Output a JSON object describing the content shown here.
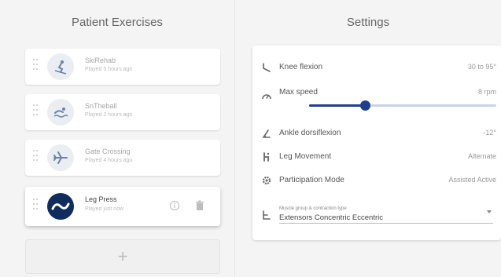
{
  "left_panel": {
    "title": "Patient Exercises",
    "exercises": [
      {
        "name": "SkiRehab",
        "subtitle": "Played 5 hours ago",
        "icon": "skier-icon"
      },
      {
        "name": "SnTheball",
        "subtitle": "Played 2 hours ago",
        "icon": "swimmer-icon"
      },
      {
        "name": "Gate Crossing",
        "subtitle": "Played 4 hours ago",
        "icon": "airplane-icon"
      },
      {
        "name": "Leg Press",
        "subtitle": "Played just now",
        "icon": "wave-icon"
      }
    ],
    "add_label": "+"
  },
  "right_panel": {
    "title": "Settings",
    "rows": [
      {
        "label": "Knee flexion",
        "value": "30 to 95°",
        "icon": "knee-icon"
      },
      {
        "label": "Max speed",
        "value": "8 rpm",
        "icon": "speedometer-icon"
      },
      {
        "label": "Ankle dorsiflexion",
        "value": "-12°",
        "icon": "angle-icon"
      },
      {
        "label": "Leg Movement",
        "value": "Alternate",
        "icon": "legs-icon"
      },
      {
        "label": "Participation Mode",
        "value": "Assisted Active",
        "icon": "gear-icon"
      }
    ],
    "max_speed_level": 0.3,
    "select": {
      "small_label": "Muscle group & contraction type",
      "value": "Extensors Concentric Eccentric",
      "icon": "muscle-icon"
    }
  },
  "colors": {
    "accent": "#1e3f8c",
    "active_icon_bg": "#0f2c5e",
    "background": "#f4f4f5"
  }
}
